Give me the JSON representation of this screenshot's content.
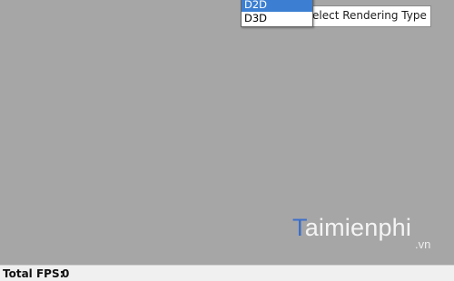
{
  "renderer_select": {
    "label": "elect Rendering Type",
    "options": [
      "D2D",
      "D3D"
    ],
    "selected_index": 0,
    "selected_color": "#3c7fd2"
  },
  "watermark": {
    "brand_name_initial": "T",
    "brand_name_rest": "aimienphi",
    "brand_suffix": ".vn",
    "accent_color": "#3c6ec9"
  },
  "status_bar": {
    "label": "Total FPS:",
    "value": "0"
  },
  "colors": {
    "canvas_background": "#a6a6a6",
    "status_bar_background": "#f0f0f0"
  }
}
